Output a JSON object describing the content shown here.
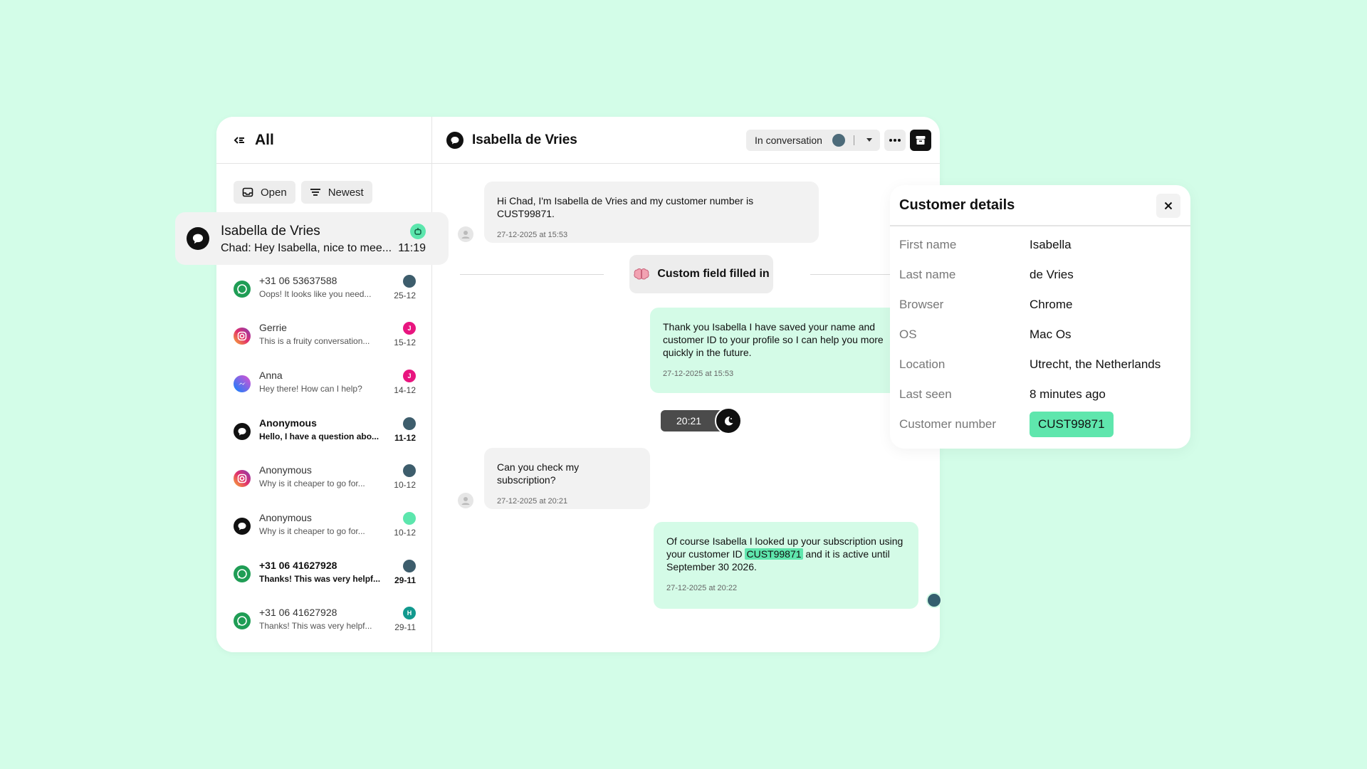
{
  "sidebar": {
    "title": "All",
    "filters": [
      {
        "label": "Open",
        "icon": "inbox-icon"
      },
      {
        "label": "Newest",
        "icon": "sort-icon"
      }
    ],
    "active_conversation": {
      "name": "Isabella de Vries",
      "snippet": "Chad: Hey Isabella, nice to mee...",
      "time": "11:19",
      "channel": "chat"
    },
    "conversations": [
      {
        "name": "+31 06 53637588",
        "snippet": "Oops! It looks like you need...",
        "date": "25-12",
        "channel": "whatsapp",
        "badge": "",
        "badge_color": "#3d5d6c",
        "bold": false
      },
      {
        "name": "Gerrie",
        "snippet": "This is a fruity conversation...",
        "date": "15-12",
        "channel": "instagram",
        "badge": "J",
        "badge_color": "#e8157f",
        "bold": false
      },
      {
        "name": "Anna",
        "snippet": "Hey there! How can I help?",
        "date": "14-12",
        "channel": "messenger",
        "badge": "J",
        "badge_color": "#e8157f",
        "bold": false
      },
      {
        "name": "Anonymous",
        "snippet": "Hello, I have a question abo...",
        "date": "11-12",
        "channel": "chat",
        "badge": "",
        "badge_color": "#3d5d6c",
        "bold": true
      },
      {
        "name": "Anonymous",
        "snippet": "Why is it cheaper to go for...",
        "date": "10-12",
        "channel": "instagram",
        "badge": "",
        "badge_color": "#3d5d6c",
        "bold": false
      },
      {
        "name": "Anonymous",
        "snippet": "Why is it cheaper to go for...",
        "date": "10-12",
        "channel": "chat",
        "badge": "",
        "badge_color": "#5ce6ad",
        "bold": false
      },
      {
        "name": "+31 06 41627928",
        "snippet": "Thanks! This was very helpf...",
        "date": "29-11",
        "channel": "whatsapp",
        "badge": "",
        "badge_color": "#3d5d6c",
        "bold": true
      },
      {
        "name": "+31 06 41627928",
        "snippet": "Thanks! This was very helpf...",
        "date": "29-11",
        "channel": "whatsapp",
        "badge": "H",
        "badge_color": "#11998e",
        "bold": false
      }
    ]
  },
  "chat": {
    "contact_name": "Isabella de Vries",
    "status": "In conversation",
    "messages": [
      {
        "direction": "in",
        "text": "Hi Chad, I'm Isabella de Vries and my customer number is CUST99871.",
        "time": "27-12-2025 at 15:53"
      },
      {
        "direction": "out",
        "text": "Thank you Isabella I have saved your name and customer ID to your profile so I can help you more quickly in the future.",
        "time": "27-12-2025 at 15:53"
      },
      {
        "direction": "in",
        "text": "Can you check my subscription?",
        "time": "27-12-2025 at 20:21"
      },
      {
        "direction": "out",
        "text_before": "Of course Isabella I looked up your subscription using your customer ID ",
        "highlight": "CUST99871",
        "text_after": " and it is active until September 30 2026.",
        "time": "27-12-2025 at 20:22"
      }
    ],
    "event": {
      "label": "Custom field filled in",
      "icon": "brain-icon"
    },
    "night_toggle": {
      "time": "20:21",
      "icon": "moon-icon"
    }
  },
  "details": {
    "title": "Customer details",
    "fields": [
      {
        "key": "First name",
        "value": "Isabella"
      },
      {
        "key": "Last name",
        "value": "de Vries"
      },
      {
        "key": "Browser",
        "value": "Chrome"
      },
      {
        "key": "OS",
        "value": "Mac Os"
      },
      {
        "key": "Location",
        "value": "Utrecht, the Netherlands"
      },
      {
        "key": "Last seen",
        "value": "8 minutes ago"
      },
      {
        "key": "Customer number",
        "value": "CUST99871"
      }
    ]
  },
  "colors": {
    "background": "#d3fde8",
    "accent": "#5fe6ad",
    "outgoing_bubble": "#d4fbe7",
    "incoming_bubble": "#f2f2f2"
  }
}
